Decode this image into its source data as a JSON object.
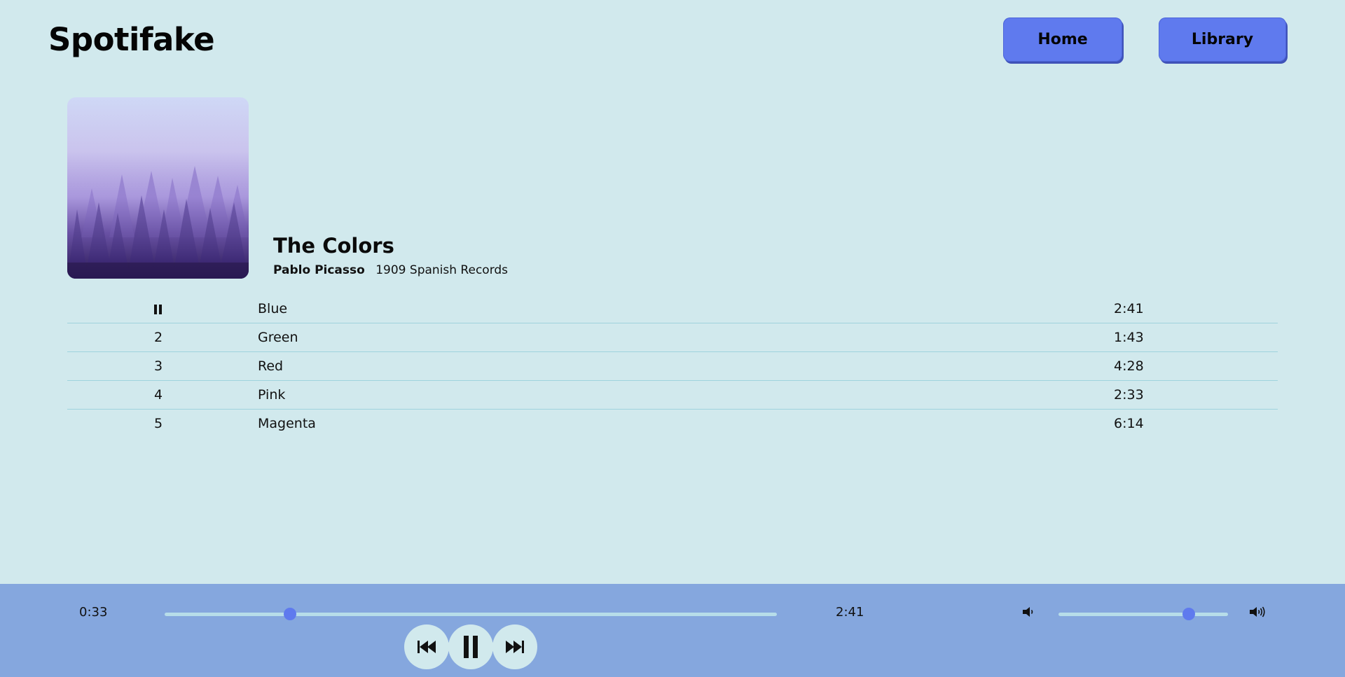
{
  "app": {
    "title": "Spotifake"
  },
  "nav": {
    "home_label": "Home",
    "library_label": "Library"
  },
  "album": {
    "title": "The Colors",
    "artist": "Pablo Picasso",
    "label": "1909 Spanish Records"
  },
  "tracks": [
    {
      "number": "",
      "name": "Blue",
      "duration": "2:41",
      "playing": true
    },
    {
      "number": "2",
      "name": "Green",
      "duration": "1:43"
    },
    {
      "number": "3",
      "name": "Red",
      "duration": "4:28"
    },
    {
      "number": "4",
      "name": "Pink",
      "duration": "2:33"
    },
    {
      "number": "5",
      "name": "Magenta",
      "duration": "6:14"
    }
  ],
  "player": {
    "current_time": "0:33",
    "total_time": "2:41",
    "progress_fraction": 0.205,
    "volume_fraction": 0.77,
    "icons": {
      "prev": "skip-previous-icon",
      "play": "pause-icon",
      "next": "skip-next-icon",
      "volume_low": "volume-low-icon",
      "volume_high": "volume-high-icon"
    }
  },
  "colors": {
    "background": "#d1e9ed",
    "accent": "#5f7aee",
    "player_bar": "#85a7de",
    "track_divider": "#9fd3dd"
  }
}
